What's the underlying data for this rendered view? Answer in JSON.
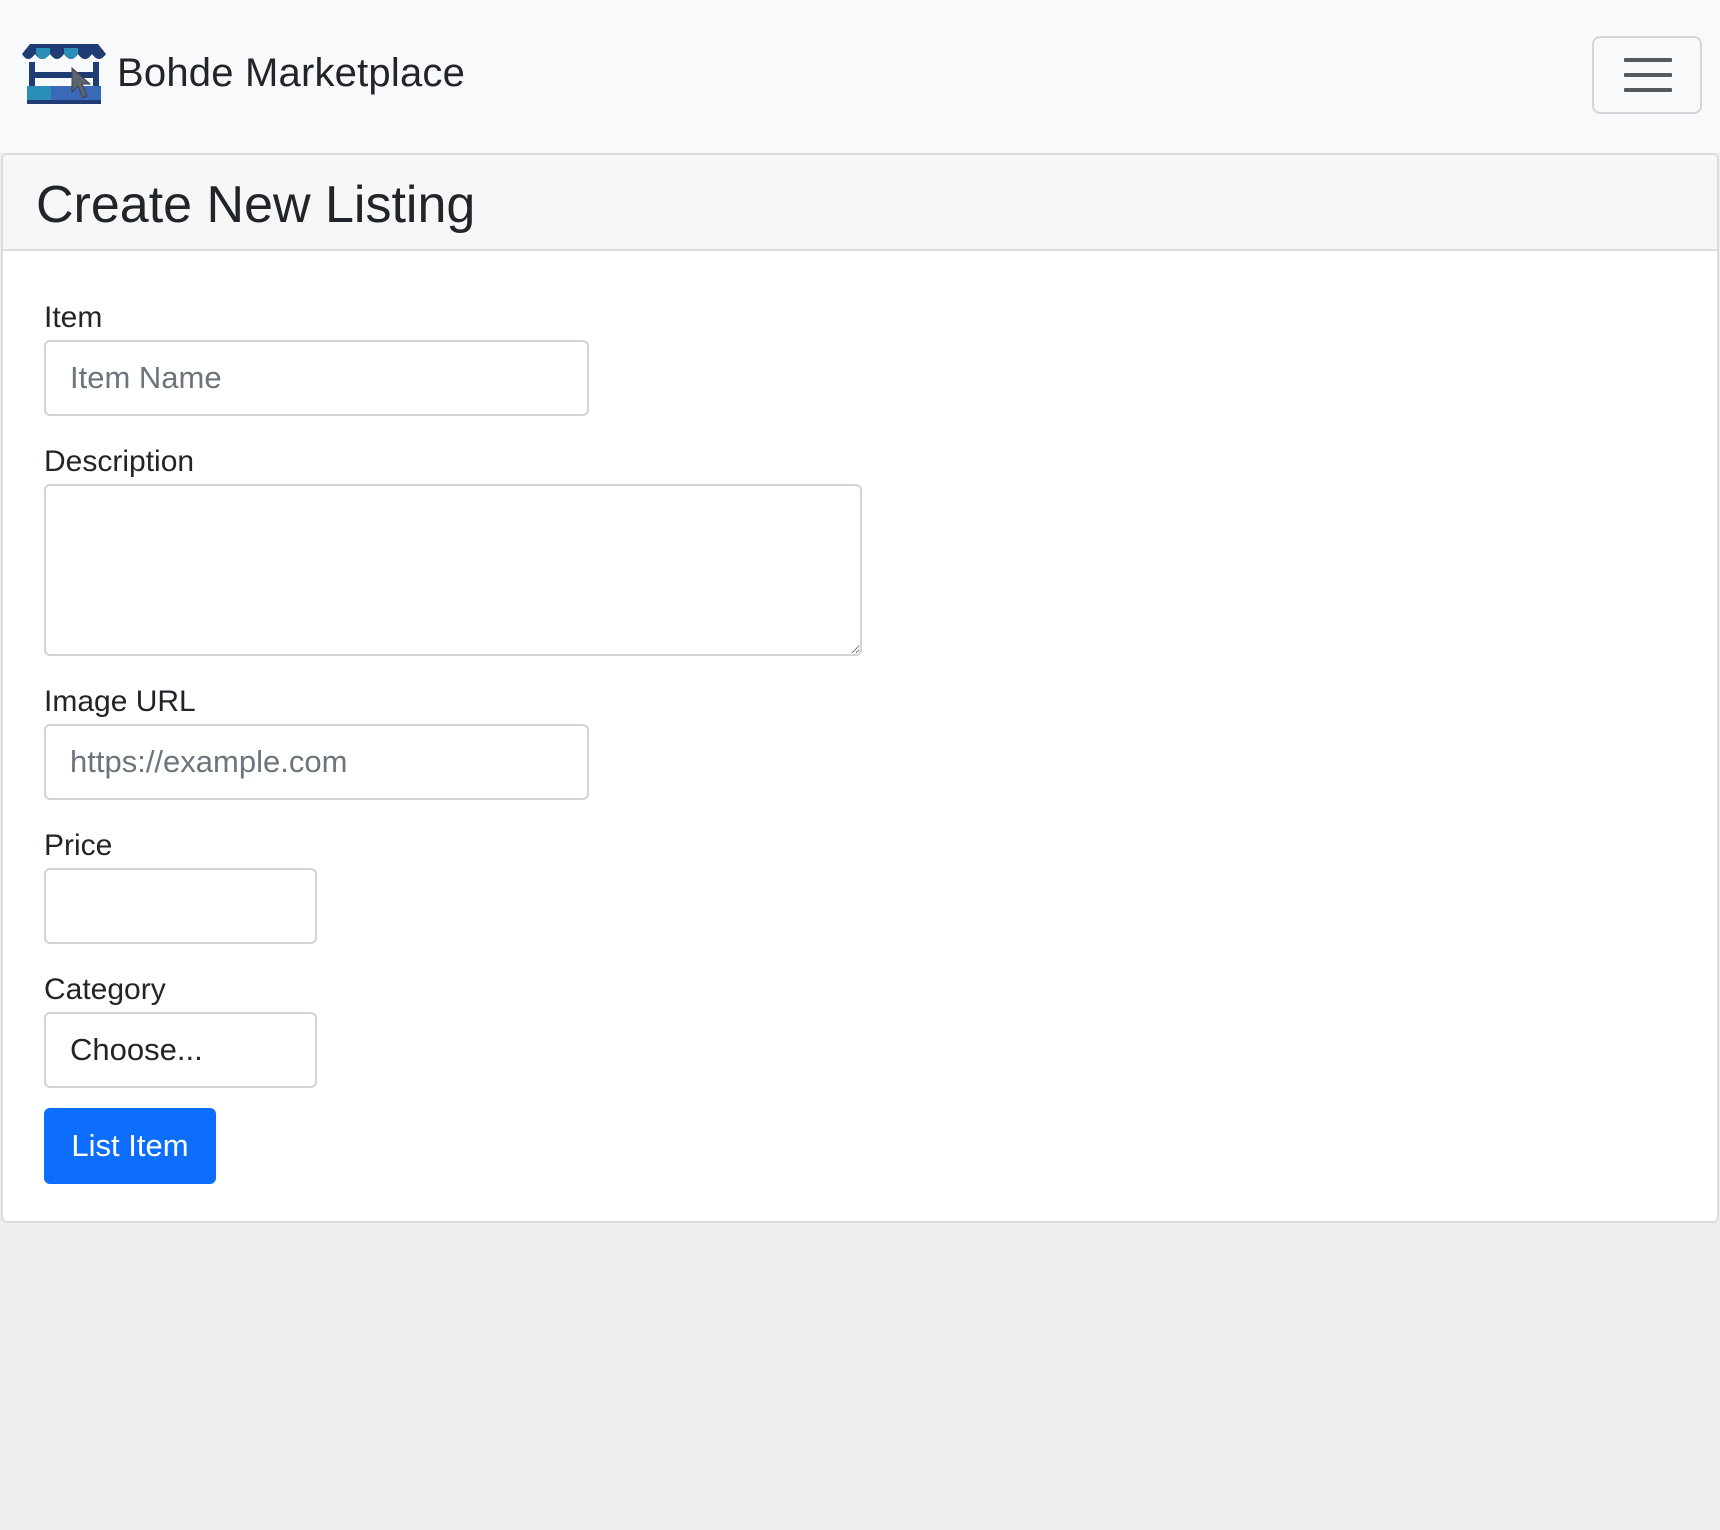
{
  "navbar": {
    "brand": "Bohde Marketplace",
    "logo_icon": "storefront-icon",
    "toggler_icon": "hamburger-menu-icon"
  },
  "form": {
    "title": "Create New Listing",
    "item": {
      "label": "Item",
      "placeholder": "Item Name",
      "value": ""
    },
    "description": {
      "label": "Description",
      "placeholder": "",
      "value": ""
    },
    "image_url": {
      "label": "Image URL",
      "placeholder": "https://example.com",
      "value": ""
    },
    "price": {
      "label": "Price",
      "placeholder": "",
      "value": ""
    },
    "category": {
      "label": "Category",
      "selected": "Choose..."
    },
    "submit_label": "List Item"
  },
  "colors": {
    "primary": "#0d6efd",
    "navbar_bg": "#f8f9fa",
    "page_bg": "#eeeeee",
    "logo_dark_blue": "#1f3c75",
    "logo_teal": "#2a8fb8"
  }
}
